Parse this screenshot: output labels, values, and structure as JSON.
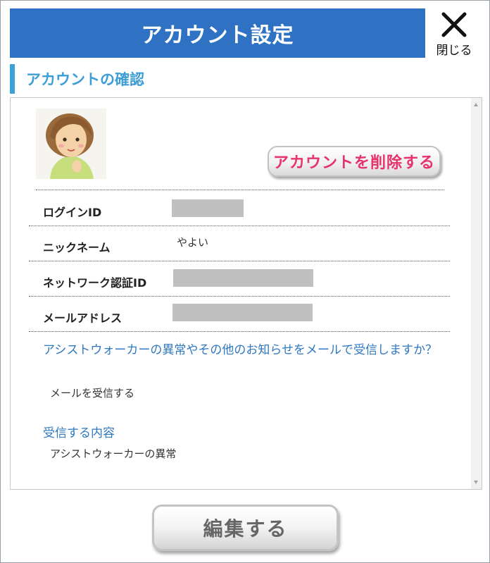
{
  "dialog": {
    "title": "アカウント設定",
    "close_label": "閉じる"
  },
  "section": {
    "heading": "アカウントの確認"
  },
  "account": {
    "delete_button": "アカウントを削除する",
    "rows": [
      {
        "label": "ログインID",
        "value": ""
      },
      {
        "label": "ニックネーム",
        "value": "やよい"
      },
      {
        "label": "ネットワーク認証ID",
        "value": ""
      },
      {
        "label": "メールアドレス",
        "value": ""
      }
    ]
  },
  "notifications": {
    "question": "アシストウォーカーの異常やその他のお知らせをメールで受信しますか？",
    "answer": "メールを受信する",
    "content_heading": "受信する内容",
    "content_value": "アシストウォーカーの異常"
  },
  "footer": {
    "edit_button": "編集する"
  },
  "colors": {
    "title_bar": "#2f72c4",
    "accent": "#3da0d8",
    "delete_text": "#e6336c",
    "link_text": "#2f78c0"
  }
}
